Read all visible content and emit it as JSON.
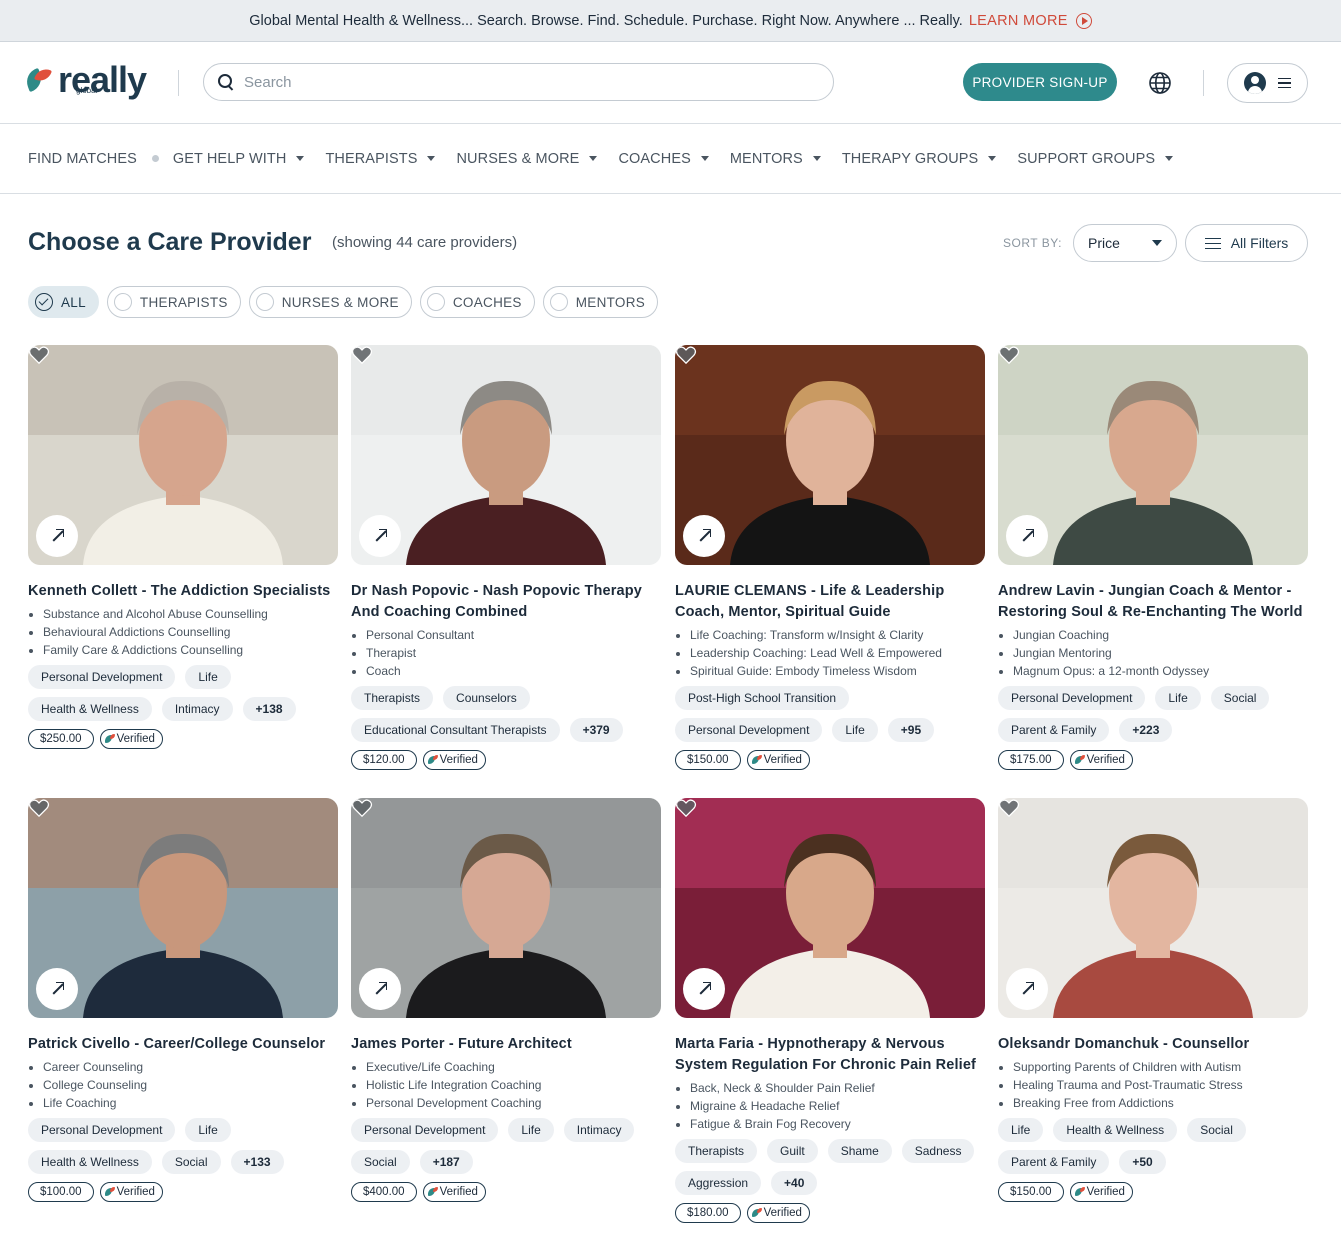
{
  "announcement": {
    "text": "Global Mental Health & Wellness... Search. Browse. Find. Schedule. Purchase. Right Now. Anywhere ... Really.",
    "link": "LEARN MORE"
  },
  "header": {
    "logo_text": "really",
    "logo_sub": "global",
    "search_placeholder": "Search",
    "signup_label": "PROVIDER SIGN-UP"
  },
  "nav": {
    "items": [
      {
        "label": "FIND MATCHES"
      },
      {
        "label": "GET HELP WITH"
      },
      {
        "label": "THERAPISTS"
      },
      {
        "label": "NURSES & MORE"
      },
      {
        "label": "COACHES"
      },
      {
        "label": "MENTORS"
      },
      {
        "label": "THERAPY GROUPS"
      },
      {
        "label": "SUPPORT GROUPS"
      }
    ]
  },
  "listing": {
    "title": "Choose a Care Provider",
    "showing": "(showing 44 care providers)",
    "sort_label": "SORT BY:",
    "sort_value": "Price",
    "filters_label": "All Filters"
  },
  "chips": [
    {
      "label": "ALL",
      "active": true
    },
    {
      "label": "THERAPISTS",
      "active": false
    },
    {
      "label": "NURSES & MORE",
      "active": false
    },
    {
      "label": "COACHES",
      "active": false
    },
    {
      "label": "MENTORS",
      "active": false
    }
  ],
  "verified_label": "Verified",
  "providers": [
    {
      "name": "Kenneth Collett - The Addiction Specialists",
      "bullets": [
        "Substance and Alcohol Abuse Counselling",
        "Behavioural Addictions Counselling",
        "Family Care & Addictions Counselling"
      ],
      "tags": [
        "Personal Development",
        "Life",
        "Health & Wellness",
        "Intimacy"
      ],
      "more": "+138",
      "price": "$250.00"
    },
    {
      "name": "Dr Nash Popovic - Nash Popovic Therapy And Coaching Combined",
      "bullets": [
        "Personal Consultant",
        "Therapist",
        "Coach"
      ],
      "tags": [
        "Therapists",
        "Counselors",
        "Educational Consultant Therapists"
      ],
      "more": "+379",
      "price": "$120.00"
    },
    {
      "name": "LAURIE CLEMANS - Life & Leadership Coach, Mentor, Spiritual Guide",
      "bullets": [
        "Life Coaching: Transform w/Insight & Clarity",
        "Leadership Coaching: Lead Well & Empowered",
        "Spiritual Guide: Embody Timeless Wisdom"
      ],
      "tags": [
        "Post-High School Transition",
        "Personal Development",
        "Life"
      ],
      "more": "+95",
      "price": "$150.00"
    },
    {
      "name": "Andrew Lavin - Jungian Coach & Mentor - Restoring Soul & Re-Enchanting The World",
      "bullets": [
        "Jungian Coaching",
        "Jungian Mentoring",
        "Magnum Opus: a 12-month Odyssey"
      ],
      "tags": [
        "Personal Development",
        "Life",
        "Social",
        "Parent & Family"
      ],
      "more": "+223",
      "price": "$175.00"
    },
    {
      "name": "Patrick Civello - Career/College Counselor",
      "bullets": [
        "Career Counseling",
        "College Counseling",
        "Life Coaching"
      ],
      "tags": [
        "Personal Development",
        "Life",
        "Health & Wellness",
        "Social"
      ],
      "more": "+133",
      "price": "$100.00"
    },
    {
      "name": "James Porter - Future Architect",
      "bullets": [
        "Executive/Life Coaching",
        "Holistic Life Integration Coaching",
        "Personal Development Coaching"
      ],
      "tags": [
        "Personal Development",
        "Life",
        "Intimacy",
        "Social"
      ],
      "more": "+187",
      "price": "$400.00"
    },
    {
      "name": "Marta Faria - Hypnotherapy & Nervous System Regulation For Chronic Pain Relief",
      "bullets": [
        "Back, Neck & Shoulder Pain Relief",
        "Migraine & Headache Relief",
        "Fatigue & Brain Fog Recovery"
      ],
      "tags": [
        "Therapists",
        "Guilt",
        "Shame",
        "Sadness",
        "Aggression"
      ],
      "more": "+40",
      "price": "$180.00"
    },
    {
      "name": "Oleksandr Domanchuk - Counsellor",
      "bullets": [
        "Supporting Parents of Children with Autism",
        "Healing Trauma and Post-Traumatic Stress",
        "Breaking Free from Addictions"
      ],
      "tags": [
        "Life",
        "Health & Wellness",
        "Social",
        "Parent & Family"
      ],
      "more": "+50",
      "price": "$150.00"
    }
  ],
  "colors": {
    "accent": "#2e8a8c",
    "link": "#d04a3a",
    "title": "#1f3a4d",
    "tag_bg": "#edf0f3"
  },
  "icons": [
    "play-icon",
    "search-icon",
    "globe-icon",
    "avatar-icon",
    "menu-icon",
    "caret-icon",
    "sliders-icon",
    "heart-icon",
    "arrow-icon",
    "verified-icon"
  ]
}
